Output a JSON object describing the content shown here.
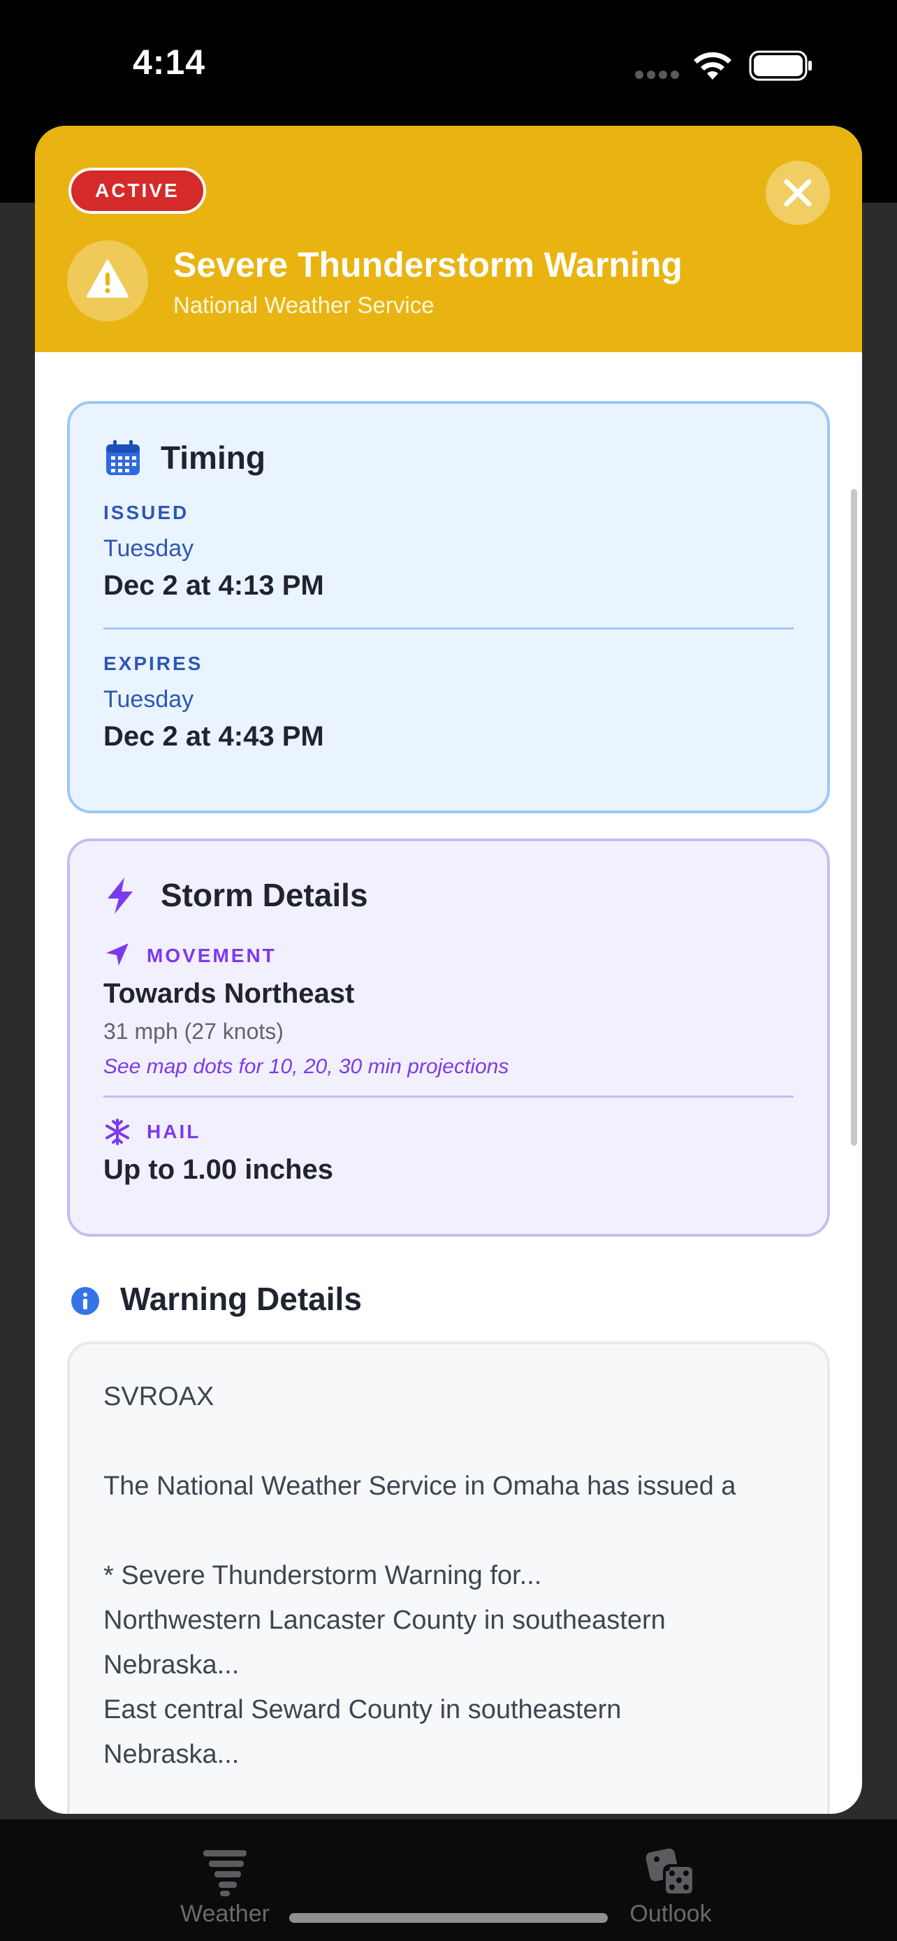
{
  "status_bar": {
    "time": "4:14"
  },
  "sheet": {
    "badge": "ACTIVE",
    "title": "Severe Thunderstorm Warning",
    "subtitle": "National Weather Service",
    "header_color": "#e9b411"
  },
  "timing": {
    "title": "Timing",
    "issued_label": "ISSUED",
    "issued_day": "Tuesday",
    "issued_value": "Dec 2 at 4:13 PM",
    "expires_label": "EXPIRES",
    "expires_day": "Tuesday",
    "expires_value": "Dec 2 at 4:43 PM"
  },
  "storm_details": {
    "title": "Storm Details",
    "movement_label": "MOVEMENT",
    "movement_value": "Towards Northeast",
    "movement_speed": "31 mph (27 knots)",
    "movement_note": "See map dots for 10, 20, 30 min projections",
    "hail_label": "HAIL",
    "hail_value": "Up to 1.00 inches"
  },
  "warning_details": {
    "title": "Warning Details",
    "lines": [
      "SVROAX",
      "The National Weather Service in Omaha has issued a",
      "* Severe Thunderstorm Warning for...",
      "Northwestern Lancaster County in southeastern",
      "Nebraska...",
      "East central Seward County in southeastern",
      "Nebraska..."
    ]
  },
  "tab_bar": {
    "tabs": [
      {
        "label": "Weather",
        "icon": "tornado-icon"
      },
      {
        "label": "Outlook",
        "icon": "dice-icon"
      }
    ]
  }
}
